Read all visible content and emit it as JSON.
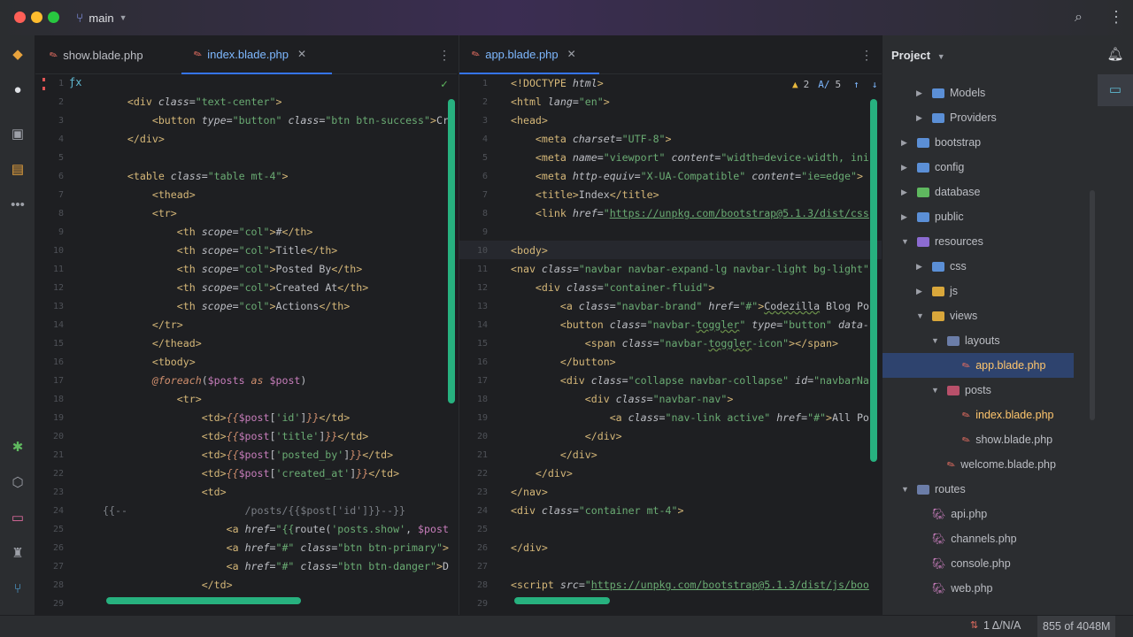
{
  "window": {
    "branch": "main"
  },
  "left_tabs": [
    {
      "label": "show.blade.php",
      "active": false
    },
    {
      "label": "index.blade.php",
      "active": true
    }
  ],
  "right_tabs": [
    {
      "label": "app.blade.php",
      "active": true
    }
  ],
  "inspections": {
    "warnings": "2",
    "typos": "5"
  },
  "left_editor": {
    "lines": [
      {
        "n": "1",
        "h": ""
      },
      {
        "n": "2",
        "h": "    <span class=t>&lt;div</span> <span class=a>class</span>=<span class=s>\"text-center\"</span><span class=t>&gt;</span>"
      },
      {
        "n": "3",
        "h": "        <span class=t>&lt;button</span> <span class=a>type</span>=<span class=s>\"button\"</span> <span class=a>class</span>=<span class=s>\"btn btn-success\"</span><span class=t>&gt;</span>Cr"
      },
      {
        "n": "4",
        "h": "    <span class=t>&lt;/div&gt;</span>"
      },
      {
        "n": "5",
        "h": ""
      },
      {
        "n": "6",
        "h": "    <span class=t>&lt;table</span> <span class=a>class</span>=<span class=s>\"table mt-4\"</span><span class=t>&gt;</span>"
      },
      {
        "n": "7",
        "h": "        <span class=t>&lt;thead&gt;</span>"
      },
      {
        "n": "8",
        "h": "        <span class=t>&lt;tr&gt;</span>"
      },
      {
        "n": "9",
        "h": "            <span class=t>&lt;th</span> <span class=a>scope</span>=<span class=s>\"col\"</span><span class=t>&gt;</span>#<span class=t>&lt;/th&gt;</span>"
      },
      {
        "n": "10",
        "h": "            <span class=t>&lt;th</span> <span class=a>scope</span>=<span class=s>\"col\"</span><span class=t>&gt;</span>Title<span class=t>&lt;/th&gt;</span>"
      },
      {
        "n": "11",
        "h": "            <span class=t>&lt;th</span> <span class=a>scope</span>=<span class=s>\"col\"</span><span class=t>&gt;</span>Posted By<span class=t>&lt;/th&gt;</span>"
      },
      {
        "n": "12",
        "h": "            <span class=t>&lt;th</span> <span class=a>scope</span>=<span class=s>\"col\"</span><span class=t>&gt;</span>Created At<span class=t>&lt;/th&gt;</span>"
      },
      {
        "n": "13",
        "h": "            <span class=t>&lt;th</span> <span class=a>scope</span>=<span class=s>\"col\"</span><span class=t>&gt;</span>Actions<span class=t>&lt;/th&gt;</span>"
      },
      {
        "n": "14",
        "h": "        <span class=t>&lt;/tr&gt;</span>"
      },
      {
        "n": "15",
        "h": "        <span class=t>&lt;/thead&gt;</span>"
      },
      {
        "n": "16",
        "h": "        <span class=t>&lt;tbody&gt;</span>"
      },
      {
        "n": "17",
        "h": "        <span class=kw>@foreach</span>(<span class=v>$posts</span> <span class=kw>as</span> <span class=v>$post</span>)"
      },
      {
        "n": "18",
        "h": "            <span class=t>&lt;tr&gt;</span>"
      },
      {
        "n": "19",
        "h": "                <span class=t>&lt;td&gt;</span><span class=kw>{{</span><span class=v>$post</span>[<span class=s>'id'</span>]<span class=kw>}}</span><span class=t>&lt;/td&gt;</span>"
      },
      {
        "n": "20",
        "h": "                <span class=t>&lt;td&gt;</span><span class=kw>{{</span><span class=v>$post</span>[<span class=s>'title'</span>]<span class=kw>}}</span><span class=t>&lt;/td&gt;</span>"
      },
      {
        "n": "21",
        "h": "                <span class=t>&lt;td&gt;</span><span class=kw>{{</span><span class=v>$post</span>[<span class=s>'posted_by'</span>]<span class=kw>}}</span><span class=t>&lt;/td&gt;</span>"
      },
      {
        "n": "22",
        "h": "                <span class=t>&lt;td&gt;</span><span class=kw>{{</span><span class=v>$post</span>[<span class=s>'created_at'</span>]<span class=kw>}}</span><span class=t>&lt;/td&gt;</span>"
      },
      {
        "n": "23",
        "h": "                <span class=t>&lt;td&gt;</span>"
      },
      {
        "n": "24",
        "h": "<span class=cm>{{--                   /posts/{{$post['id']}}--}}</span>"
      },
      {
        "n": "25",
        "h": "                    <span class=t>&lt;a</span> <span class=a>href</span>=<span class=s>\"{{</span>route(<span class=s>'posts.show'</span>, <span class=v>$post</span>"
      },
      {
        "n": "26",
        "h": "                    <span class=t>&lt;a</span> <span class=a>href</span>=<span class=s>\"#\"</span> <span class=a>class</span>=<span class=s>\"btn btn-primary\"</span><span class=t>&gt;</span>"
      },
      {
        "n": "27",
        "h": "                    <span class=t>&lt;a</span> <span class=a>href</span>=<span class=s>\"#\"</span> <span class=a>class</span>=<span class=s>\"btn btn-danger\"</span><span class=t>&gt;</span>D"
      },
      {
        "n": "28",
        "h": "                <span class=t>&lt;/td&gt;</span>"
      },
      {
        "n": "29",
        "h": ""
      }
    ]
  },
  "right_editor": {
    "lines": [
      {
        "n": "1",
        "h": "<span class=t>&lt;!DOCTYPE</span> <span class=a>html</span><span class=t>&gt;</span>"
      },
      {
        "n": "2",
        "h": "<span class=t>&lt;html</span> <span class=a>lang</span>=<span class=s>\"en\"</span><span class=t>&gt;</span>"
      },
      {
        "n": "3",
        "h": "<span class=t>&lt;head&gt;</span>"
      },
      {
        "n": "4",
        "h": "    <span class=t>&lt;meta</span> <span class=a>charset</span>=<span class=s>\"UTF-8\"</span><span class=t>&gt;</span>"
      },
      {
        "n": "5",
        "h": "    <span class=t>&lt;meta</span> <span class=a>name</span>=<span class=s>\"viewport\"</span> <span class=a>content</span>=<span class=s>\"width=device-width, ini</span>"
      },
      {
        "n": "6",
        "h": "    <span class=t>&lt;meta</span> <span class=a>http-equiv</span>=<span class=s>\"X-UA-Compatible\"</span> <span class=a>content</span>=<span class=s>\"ie=edge\"</span><span class=t>&gt;</span>"
      },
      {
        "n": "7",
        "h": "    <span class=t>&lt;title&gt;</span>Index<span class=t>&lt;/title&gt;</span>"
      },
      {
        "n": "8",
        "h": "    <span class=t>&lt;link</span> <span class=a>href</span>=<span class=s>\"<span class=url>https://unpkg.com/bootstrap@5.1.3/dist/css</span></span>"
      },
      {
        "n": "9",
        "h": ""
      },
      {
        "n": "10",
        "h": "<span class=t>&lt;body&gt;</span>"
      },
      {
        "n": "11",
        "h": "<span class=t>&lt;nav</span> <span class=a>class</span>=<span class=s>\"navbar navbar-expand-lg navbar-light bg-light\"</span>"
      },
      {
        "n": "12",
        "h": "    <span class=t>&lt;div</span> <span class=a>class</span>=<span class=s>\"container-fluid\"</span><span class=t>&gt;</span>"
      },
      {
        "n": "13",
        "h": "        <span class=t>&lt;a</span> <span class=a>class</span>=<span class=s>\"navbar-brand\"</span> <span class=a>href</span>=<span class=s>\"#\"</span><span class=t>&gt;</span><span class=sq>Codezilla</span> Blog Po"
      },
      {
        "n": "14",
        "h": "        <span class=t>&lt;button</span> <span class=a>class</span>=<span class=s>\"navbar-<span class=sq>toggler</span>\"</span> <span class=a>type</span>=<span class=s>\"button\"</span> <span class=a>data-</span>"
      },
      {
        "n": "15",
        "h": "            <span class=t>&lt;span</span> <span class=a>class</span>=<span class=s>\"navbar-<span class=sq>toggler</span>-icon\"</span><span class=t>&gt;&lt;/span&gt;</span>"
      },
      {
        "n": "16",
        "h": "        <span class=t>&lt;/button&gt;</span>"
      },
      {
        "n": "17",
        "h": "        <span class=t>&lt;div</span> <span class=a>class</span>=<span class=s>\"collapse navbar-collapse\"</span> <span class=a>id</span>=<span class=s>\"navbarNa</span>"
      },
      {
        "n": "18",
        "h": "            <span class=t>&lt;div</span> <span class=a>class</span>=<span class=s>\"navbar-nav\"</span><span class=t>&gt;</span>"
      },
      {
        "n": "19",
        "h": "                <span class=t>&lt;a</span> <span class=a>class</span>=<span class=s>\"nav-link active\"</span> <span class=a>href</span>=<span class=s>\"#\"</span><span class=t>&gt;</span>All Po"
      },
      {
        "n": "20",
        "h": "            <span class=t>&lt;/div&gt;</span>"
      },
      {
        "n": "21",
        "h": "        <span class=t>&lt;/div&gt;</span>"
      },
      {
        "n": "22",
        "h": "    <span class=t>&lt;/div&gt;</span>"
      },
      {
        "n": "23",
        "h": "<span class=t>&lt;/nav&gt;</span>"
      },
      {
        "n": "24",
        "h": "<span class=t>&lt;div</span> <span class=a>class</span>=<span class=s>\"container mt-4\"</span><span class=t>&gt;</span>"
      },
      {
        "n": "25",
        "h": ""
      },
      {
        "n": "26",
        "h": "<span class=t>&lt;/div&gt;</span>"
      },
      {
        "n": "27",
        "h": ""
      },
      {
        "n": "28",
        "h": "<span class=t>&lt;script</span> <span class=a>src</span>=<span class=s>\"<span class=url>https://unpkg.com/bootstrap@5.1.3/dist/js/boo</span></span>"
      },
      {
        "n": "29",
        "h": ""
      }
    ]
  },
  "project": {
    "title": "Project",
    "items": [
      {
        "label": "Models",
        "kind": "folder",
        "depth": 2,
        "chev": "right"
      },
      {
        "label": "Providers",
        "kind": "folder",
        "depth": 2,
        "chev": "right"
      },
      {
        "label": "bootstrap",
        "kind": "folder",
        "depth": 1,
        "chev": "right"
      },
      {
        "label": "config",
        "kind": "folder",
        "depth": 1,
        "chev": "right"
      },
      {
        "label": "database",
        "kind": "folder-green",
        "depth": 1,
        "chev": "right"
      },
      {
        "label": "public",
        "kind": "folder",
        "depth": 1,
        "chev": "right"
      },
      {
        "label": "resources",
        "kind": "folder-purple",
        "depth": 1,
        "chev": "down"
      },
      {
        "label": "css",
        "kind": "folder",
        "depth": 2,
        "chev": "right"
      },
      {
        "label": "js",
        "kind": "folder-yellow",
        "depth": 2,
        "chev": "right"
      },
      {
        "label": "views",
        "kind": "folder-views",
        "depth": 2,
        "chev": "down"
      },
      {
        "label": "layouts",
        "kind": "folder-dark",
        "depth": 3,
        "chev": "down"
      },
      {
        "label": "app.blade.php",
        "kind": "blade",
        "depth": 4,
        "chev": "",
        "selected": true
      },
      {
        "label": "posts",
        "kind": "folder-red",
        "depth": 3,
        "chev": "down"
      },
      {
        "label": "index.blade.php",
        "kind": "blade",
        "depth": 4,
        "chev": "",
        "open": true
      },
      {
        "label": "show.blade.php",
        "kind": "blade",
        "depth": 4,
        "chev": ""
      },
      {
        "label": "welcome.blade.php",
        "kind": "blade",
        "depth": 3,
        "chev": ""
      },
      {
        "label": "routes",
        "kind": "folder-dark",
        "depth": 1,
        "chev": "down"
      },
      {
        "label": "api.php",
        "kind": "php",
        "depth": 2,
        "chev": ""
      },
      {
        "label": "channels.php",
        "kind": "php",
        "depth": 2,
        "chev": ""
      },
      {
        "label": "console.php",
        "kind": "php",
        "depth": 2,
        "chev": ""
      },
      {
        "label": "web.php",
        "kind": "php",
        "depth": 2,
        "chev": ""
      }
    ]
  },
  "statusbar": {
    "vcs": "1 Δ/N/A",
    "memory": "855 of 4048M"
  },
  "colors": {
    "accent": "#3574f0",
    "scroll": "#27b17f",
    "tag": "#d5b778",
    "string": "#6aab73"
  }
}
